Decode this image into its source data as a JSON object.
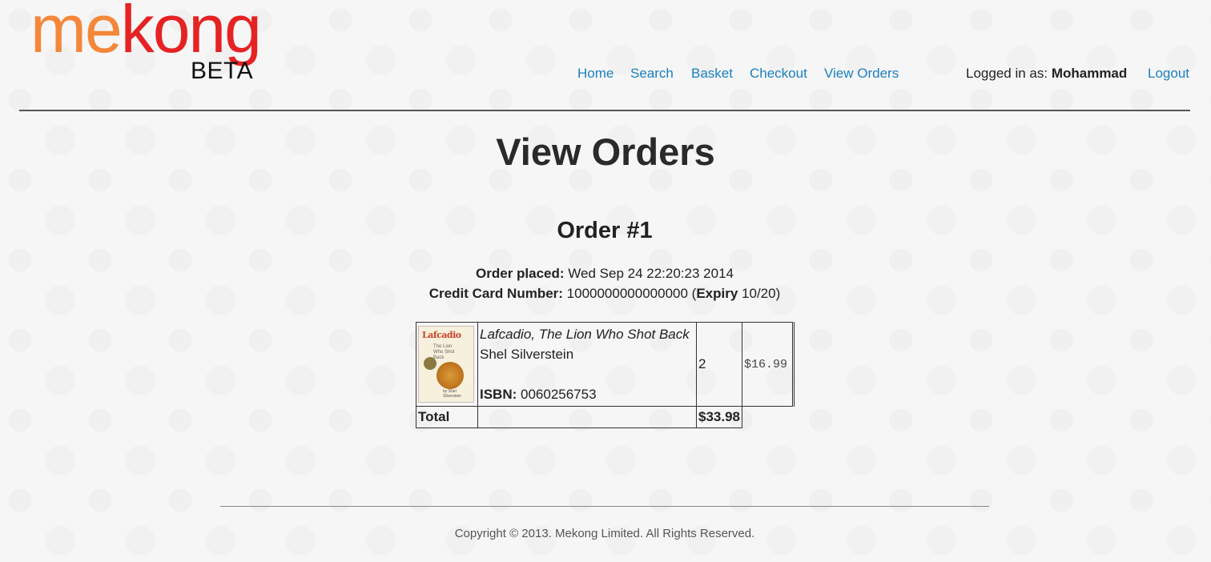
{
  "logo": {
    "part1": "me",
    "part2": "kong",
    "badge": "BETA",
    "colors": {
      "me": "#f4873a",
      "kong": "#e52323"
    }
  },
  "nav": {
    "home": "Home",
    "search": "Search",
    "basket": "Basket",
    "checkout": "Checkout",
    "view_orders": "View Orders",
    "logged_in_prefix": "Logged in as: ",
    "username": "Mohammad",
    "logout": "Logout",
    "link_color": "#1a7fbf"
  },
  "page": {
    "title": "View Orders"
  },
  "order": {
    "title": "Order #1",
    "placed_label": "Order placed:",
    "placed_value": " Wed Sep 24 22:20:23 2014",
    "card_label": "Credit Card Number:",
    "card_value": " 1000000000000000 (",
    "expiry_label": "Expiry",
    "expiry_value": " 10/20)",
    "items": [
      {
        "title": "Lafcadio, The Lion Who Shot Back",
        "author": "Shel Silverstein",
        "isbn_label": "ISBN:",
        "isbn": " 0060256753",
        "quantity": "2",
        "price": "$16.99",
        "cover_title": "Lafcadio",
        "cover_subtitle": "The Lion Who Shot Back",
        "cover_author": "by Shel Silverstein"
      }
    ],
    "total_label": "Total",
    "total_value": "$33.98"
  },
  "footer": {
    "copyright": "Copyright © 2013. Mekong Limited. All Rights Reserved."
  }
}
